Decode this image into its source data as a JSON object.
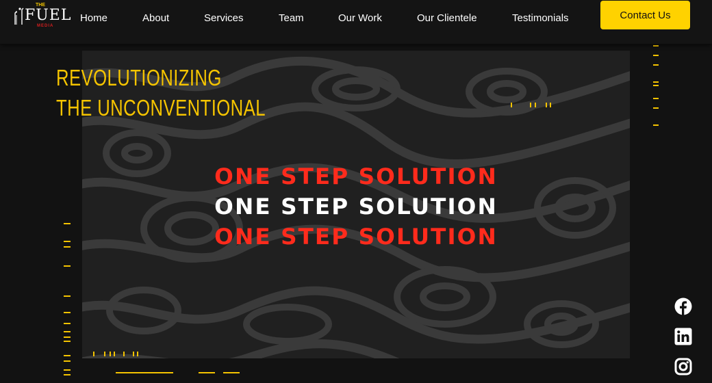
{
  "brand": {
    "logo_top": "THE",
    "logo_main": "FUEL",
    "logo_bottom": "MEDIA"
  },
  "nav": {
    "items": [
      {
        "label": "Home"
      },
      {
        "label": "About"
      },
      {
        "label": "Services"
      },
      {
        "label": "Team"
      },
      {
        "label": "Our Work"
      },
      {
        "label": "Our Clientele"
      },
      {
        "label": "Testimonials"
      }
    ],
    "cta_label": "Contact Us"
  },
  "hero": {
    "headline_line1": "REVOLUTIONIZING",
    "headline_line2": "THE UNCONVENTIONAL",
    "slogans": [
      "ONE STEP SOLUTION",
      "ONE STEP SOLUTION",
      "ONE STEP SOLUTION"
    ]
  },
  "social": {
    "icons": [
      "facebook-icon",
      "linkedin-icon",
      "instagram-icon"
    ]
  },
  "colors": {
    "accent": "#ffd200",
    "headline": "#f5c400",
    "slogan_red": "#ff2b1c",
    "background": "#121212"
  }
}
